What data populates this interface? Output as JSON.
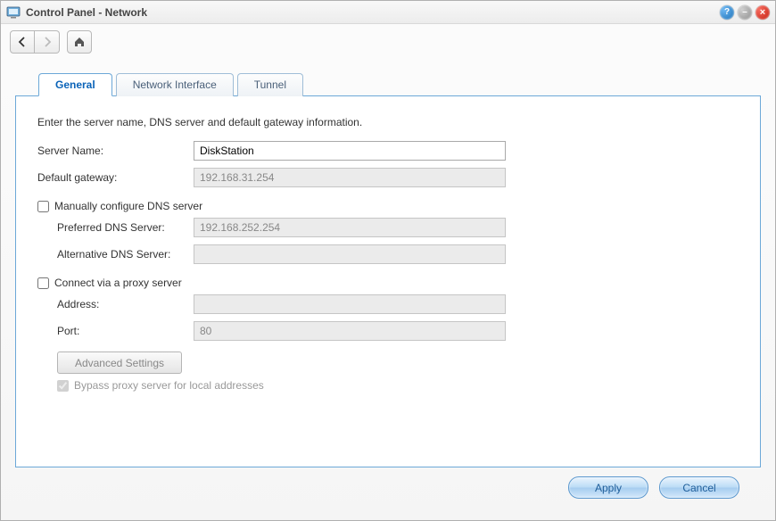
{
  "window": {
    "title": "Control Panel - Network"
  },
  "tabs": {
    "general": "General",
    "network_interface": "Network Interface",
    "tunnel": "Tunnel"
  },
  "general": {
    "intro": "Enter the server name, DNS server and default gateway information.",
    "server_name_label": "Server Name:",
    "server_name_value": "DiskStation",
    "default_gateway_label": "Default gateway:",
    "default_gateway_value": "192.168.31.254",
    "manual_dns_label": "Manually configure DNS server",
    "preferred_dns_label": "Preferred DNS Server:",
    "preferred_dns_value": "192.168.252.254",
    "alt_dns_label": "Alternative DNS Server:",
    "alt_dns_value": "",
    "proxy_label": "Connect via a proxy server",
    "proxy_address_label": "Address:",
    "proxy_address_value": "",
    "proxy_port_label": "Port:",
    "proxy_port_value": "80",
    "advanced_settings_label": "Advanced Settings",
    "bypass_proxy_label": "Bypass proxy server for local addresses"
  },
  "buttons": {
    "apply": "Apply",
    "cancel": "Cancel"
  }
}
